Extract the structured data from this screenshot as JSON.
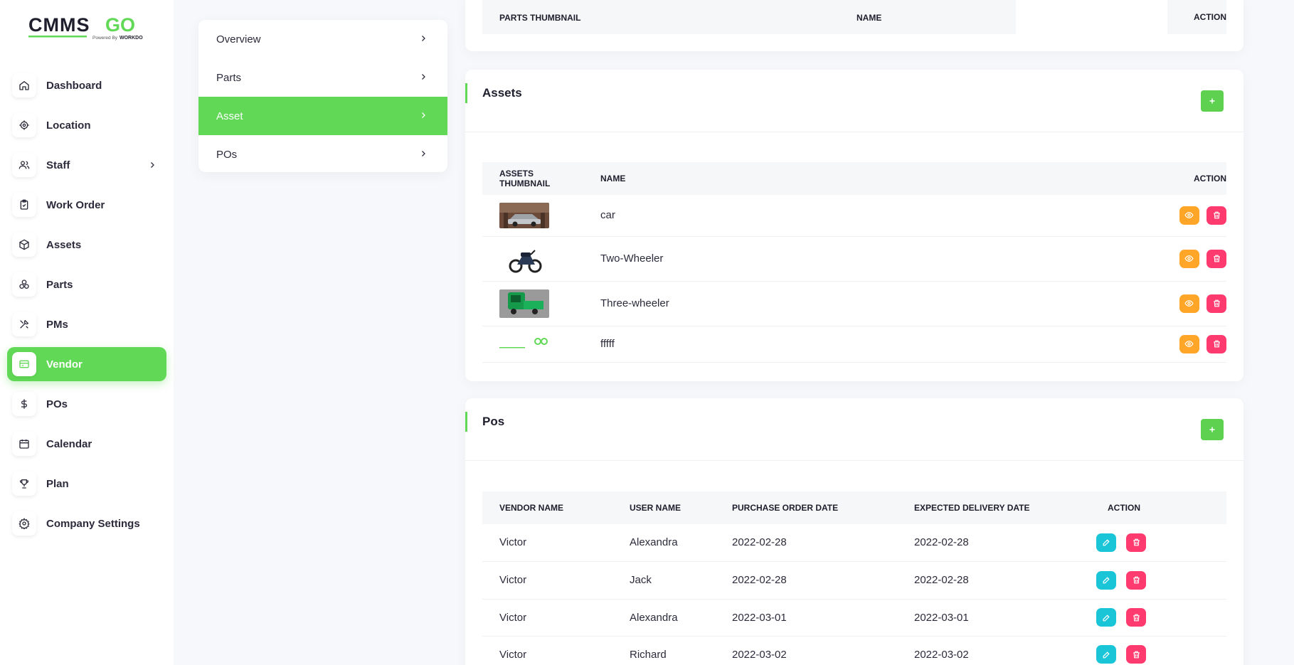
{
  "brand": {
    "name": "CMMS GO",
    "tagline": "Powered By WorkDo",
    "accent": "#61d957"
  },
  "sidebar": {
    "items": [
      {
        "label": "Dashboard",
        "icon": "home-icon"
      },
      {
        "label": "Location",
        "icon": "location-icon"
      },
      {
        "label": "Staff",
        "icon": "users-icon",
        "has_children": true
      },
      {
        "label": "Work Order",
        "icon": "clipboard-icon"
      },
      {
        "label": "Assets",
        "icon": "box-icon"
      },
      {
        "label": "Parts",
        "icon": "parts-icon"
      },
      {
        "label": "PMs",
        "icon": "tools-icon"
      },
      {
        "label": "Vendor",
        "icon": "card-icon",
        "active": true
      },
      {
        "label": "POs",
        "icon": "dollar-icon"
      },
      {
        "label": "Calendar",
        "icon": "calendar-icon"
      },
      {
        "label": "Plan",
        "icon": "trophy-icon"
      },
      {
        "label": "Company Settings",
        "icon": "gear-icon"
      }
    ]
  },
  "submenu": {
    "items": [
      {
        "label": "Overview"
      },
      {
        "label": "Parts"
      },
      {
        "label": "Asset",
        "active": true
      },
      {
        "label": "POs"
      }
    ]
  },
  "parts_card": {
    "columns": [
      "PARTS THUMBNAIL",
      "NAME",
      "ACTION"
    ]
  },
  "assets_card": {
    "title": "Assets",
    "columns": [
      "ASSETS THUMBNAIL",
      "NAME",
      "ACTION"
    ],
    "rows": [
      {
        "name": "car",
        "thumb": "car-thumbnail"
      },
      {
        "name": "Two-Wheeler",
        "thumb": "motorcycle-thumbnail"
      },
      {
        "name": "Three-wheeler",
        "thumb": "rickshaw-thumbnail"
      },
      {
        "name": "fffff",
        "thumb": "logo-thumbnail"
      }
    ]
  },
  "pos_card": {
    "title": "Pos",
    "columns": [
      "VENDOR NAME",
      "USER NAME",
      "PURCHASE ORDER DATE",
      "EXPECTED DELIVERY DATE",
      "ACTION"
    ],
    "rows": [
      {
        "vendor": "Victor",
        "user": "Alexandra",
        "po_date": "2022-02-28",
        "delivery_date": "2022-02-28"
      },
      {
        "vendor": "Victor",
        "user": "Jack",
        "po_date": "2022-02-28",
        "delivery_date": "2022-02-28"
      },
      {
        "vendor": "Victor",
        "user": "Alexandra",
        "po_date": "2022-03-01",
        "delivery_date": "2022-03-01"
      },
      {
        "vendor": "Victor",
        "user": "Richard",
        "po_date": "2022-03-02",
        "delivery_date": "2022-03-02"
      }
    ]
  }
}
